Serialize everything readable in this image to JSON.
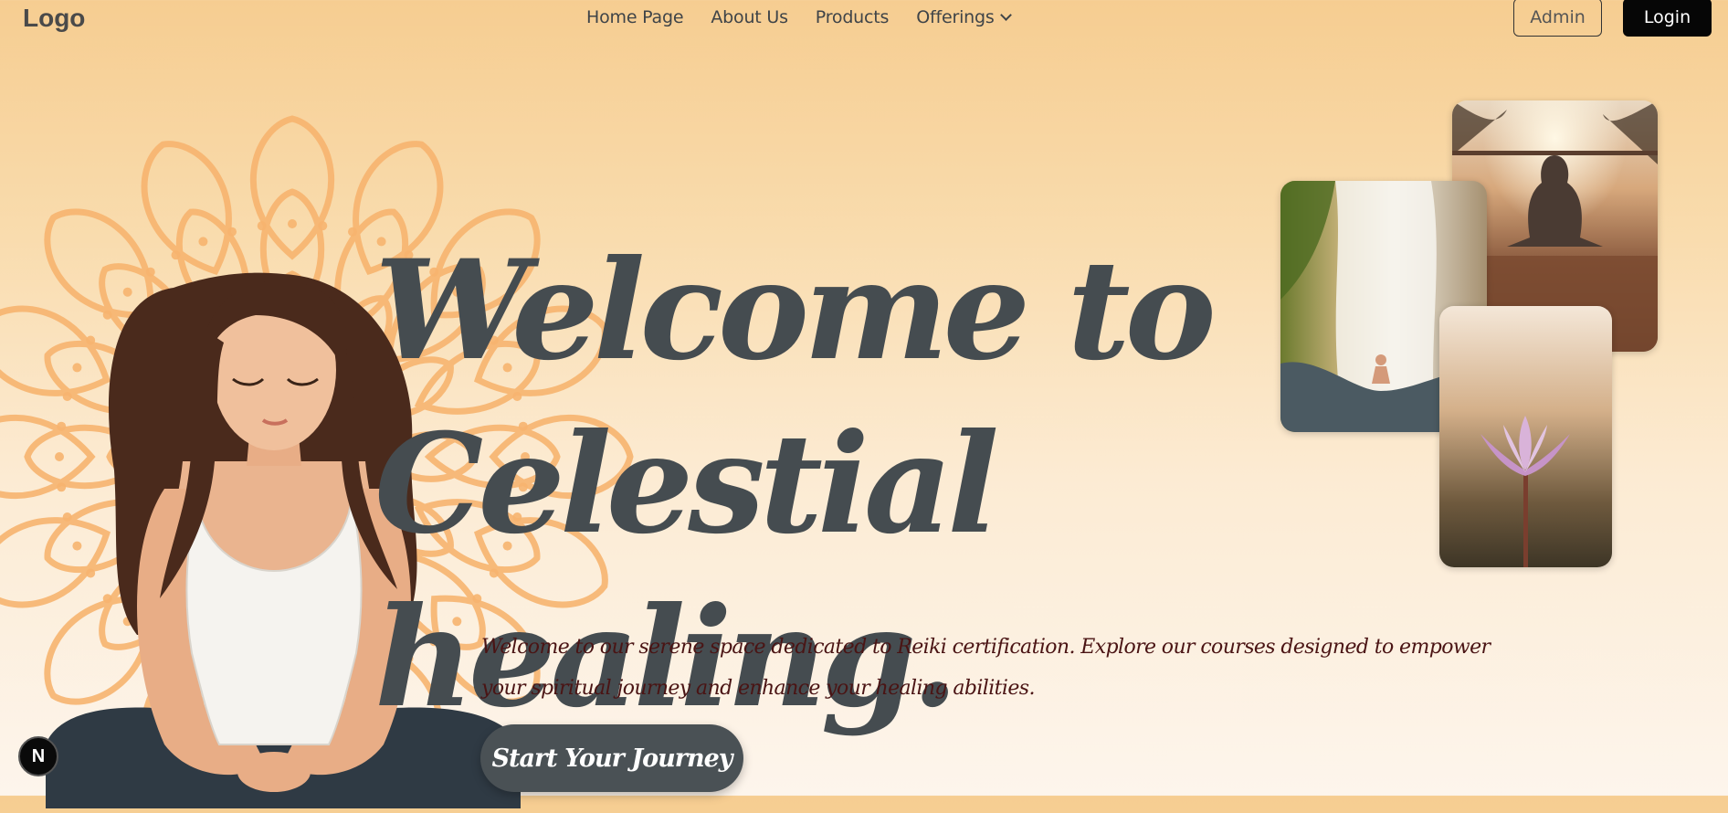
{
  "nav": {
    "logo": "Logo",
    "items": [
      {
        "label": "Home Page"
      },
      {
        "label": "About Us"
      },
      {
        "label": "Products"
      },
      {
        "label": "Offerings",
        "icon": "chevron-down-icon"
      }
    ],
    "admin_label": "Admin",
    "login_label": "Login"
  },
  "hero": {
    "headline_line1": "Welcome to",
    "headline_line2": "Celestial healing.",
    "description": "Welcome to our serene space dedicated to Reiki certification. Explore our courses designed to empower your spiritual journey and enhance your healing abilities.",
    "cta_label": "Start Your Journey"
  },
  "badge": {
    "letter": "N"
  },
  "colors": {
    "headline": "#454c50",
    "description": "#4a1414",
    "cta_bg": "#4a5155",
    "login_bg": "#060606",
    "mandala": "#f7b46f",
    "bg_top": "#f6cd91",
    "bg_bottom": "#fdf5ec"
  },
  "images": {
    "meditation_illustration": "woman-meditating-illustration",
    "mandala": "mandala-decoration",
    "photo_1": "sunset-yoga-photo",
    "photo_2": "waterfall-meditation-photo",
    "photo_3": "lotus-flower-photo"
  }
}
